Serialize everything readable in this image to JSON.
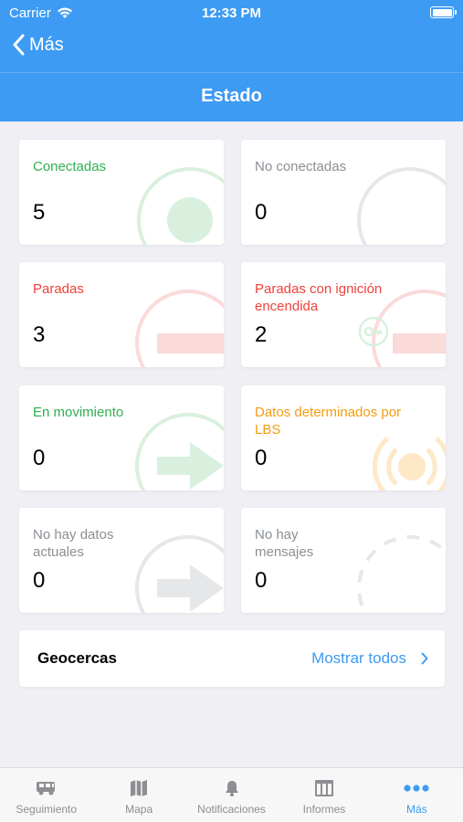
{
  "status_bar": {
    "carrier": "Carrier",
    "time": "12:33 PM"
  },
  "nav": {
    "back_label": "Más",
    "title": "Estado"
  },
  "cards": [
    {
      "label": "Conectadas",
      "value": "5",
      "color": "#2fb04f",
      "icon": "connected-circle-icon"
    },
    {
      "label": "No conectadas",
      "value": "0",
      "color": "#8a8f94",
      "icon": "disconnected-circle-icon"
    },
    {
      "label": "Paradas",
      "value": "3",
      "color": "#f0413a",
      "icon": "stopped-icon"
    },
    {
      "label": "Paradas con ignición encendida",
      "value": "2",
      "color": "#f0413a",
      "icon": "ignition-key-icon"
    },
    {
      "label": "En movimiento",
      "value": "0",
      "color": "#2fb04f",
      "icon": "moving-arrow-icon"
    },
    {
      "label": "Datos determinados por LBS",
      "value": "0",
      "color": "#f39c12",
      "icon": "lbs-signal-icon"
    },
    {
      "label": "No hay datos actuales",
      "value": "0",
      "color": "#8a8f94",
      "icon": "no-data-arrow-icon"
    },
    {
      "label": "No hay mensajes",
      "value": "0",
      "color": "#8a8f94",
      "icon": "no-messages-dashed-icon"
    }
  ],
  "geofences": {
    "title": "Geocercas",
    "link": "Mostrar todos"
  },
  "tabbar": {
    "tabs": [
      {
        "label": "Seguimiento",
        "icon": "truck-icon"
      },
      {
        "label": "Mapa",
        "icon": "map-icon"
      },
      {
        "label": "Notificaciones",
        "icon": "bell-icon"
      },
      {
        "label": "Informes",
        "icon": "table-icon"
      },
      {
        "label": "Más",
        "icon": "more-dots-icon"
      }
    ],
    "active_index": 4
  },
  "colors": {
    "accent": "#3d9bf3",
    "background": "#efeff4"
  }
}
